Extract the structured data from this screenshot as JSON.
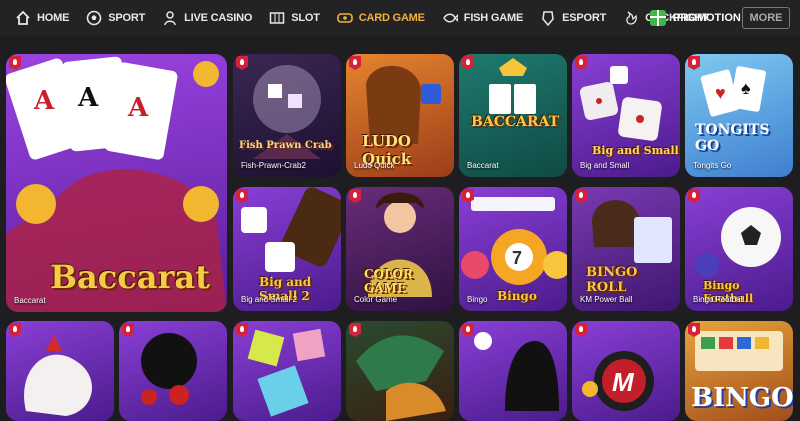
{
  "nav": {
    "items": [
      {
        "label": "HOME",
        "icon": "home-icon"
      },
      {
        "label": "SPORT",
        "icon": "soccer-ball-icon"
      },
      {
        "label": "LIVE CASINO",
        "icon": "dealer-icon"
      },
      {
        "label": "SLOT",
        "icon": "slot-machine-icon"
      },
      {
        "label": "CARD GAME",
        "icon": "cards-icon",
        "active": true
      },
      {
        "label": "FISH GAME",
        "icon": "fish-icon"
      },
      {
        "label": "ESPORT",
        "icon": "esport-icon"
      },
      {
        "label": "COCKFIGHT",
        "icon": "rooster-icon"
      }
    ],
    "promotion": "PROMOTION",
    "more": "MORE"
  },
  "games": [
    {
      "caption": "Baccarat",
      "title": "Baccarat"
    },
    {
      "caption": "Fish-Prawn-Crab2",
      "title": "Fish Prawn Crab"
    },
    {
      "caption": "Ludo Quick",
      "title": "LUDO Quick"
    },
    {
      "caption": "Baccarat",
      "title": "BACCARAT"
    },
    {
      "caption": "Big and Small",
      "title": "Big and Small"
    },
    {
      "caption": "Tongits Go",
      "title": "TONGITS GO"
    },
    {
      "caption": "Big and Small 2",
      "title": "Big and Small 2"
    },
    {
      "caption": "Color Game",
      "title": "COLOR GAME"
    },
    {
      "caption": "Bingo",
      "title": "Bingo"
    },
    {
      "caption": "KM Power Ball",
      "title": "BINGO ROLL"
    },
    {
      "caption": "Bingo Football",
      "title": "Bingo Football"
    },
    {
      "caption": "",
      "title": ""
    },
    {
      "caption": "",
      "title": ""
    },
    {
      "caption": "",
      "title": ""
    },
    {
      "caption": "",
      "title": ""
    },
    {
      "caption": "",
      "title": ""
    },
    {
      "caption": "",
      "title": ""
    },
    {
      "caption": "",
      "title": "BINGO"
    }
  ],
  "colors": {
    "active": "#f0b23c",
    "card_purple": "#7a35c8",
    "hot_badge": "#d6213a"
  }
}
